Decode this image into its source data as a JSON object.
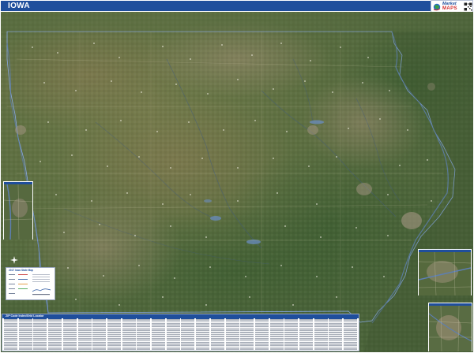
{
  "map": {
    "title": "IOWA",
    "publisher": {
      "line1": "Market",
      "line2": "MAPS",
      "icon": "globe-logo"
    }
  },
  "legend": {
    "title": "2017 Iowa State Map"
  },
  "zip_locator": {
    "title": "ZIP Code Index/Grid Locator"
  },
  "colors": {
    "title_bar": "#1f4e9c",
    "satellite_base": "#4f6a3d",
    "boundary": "#8fb2ff"
  }
}
